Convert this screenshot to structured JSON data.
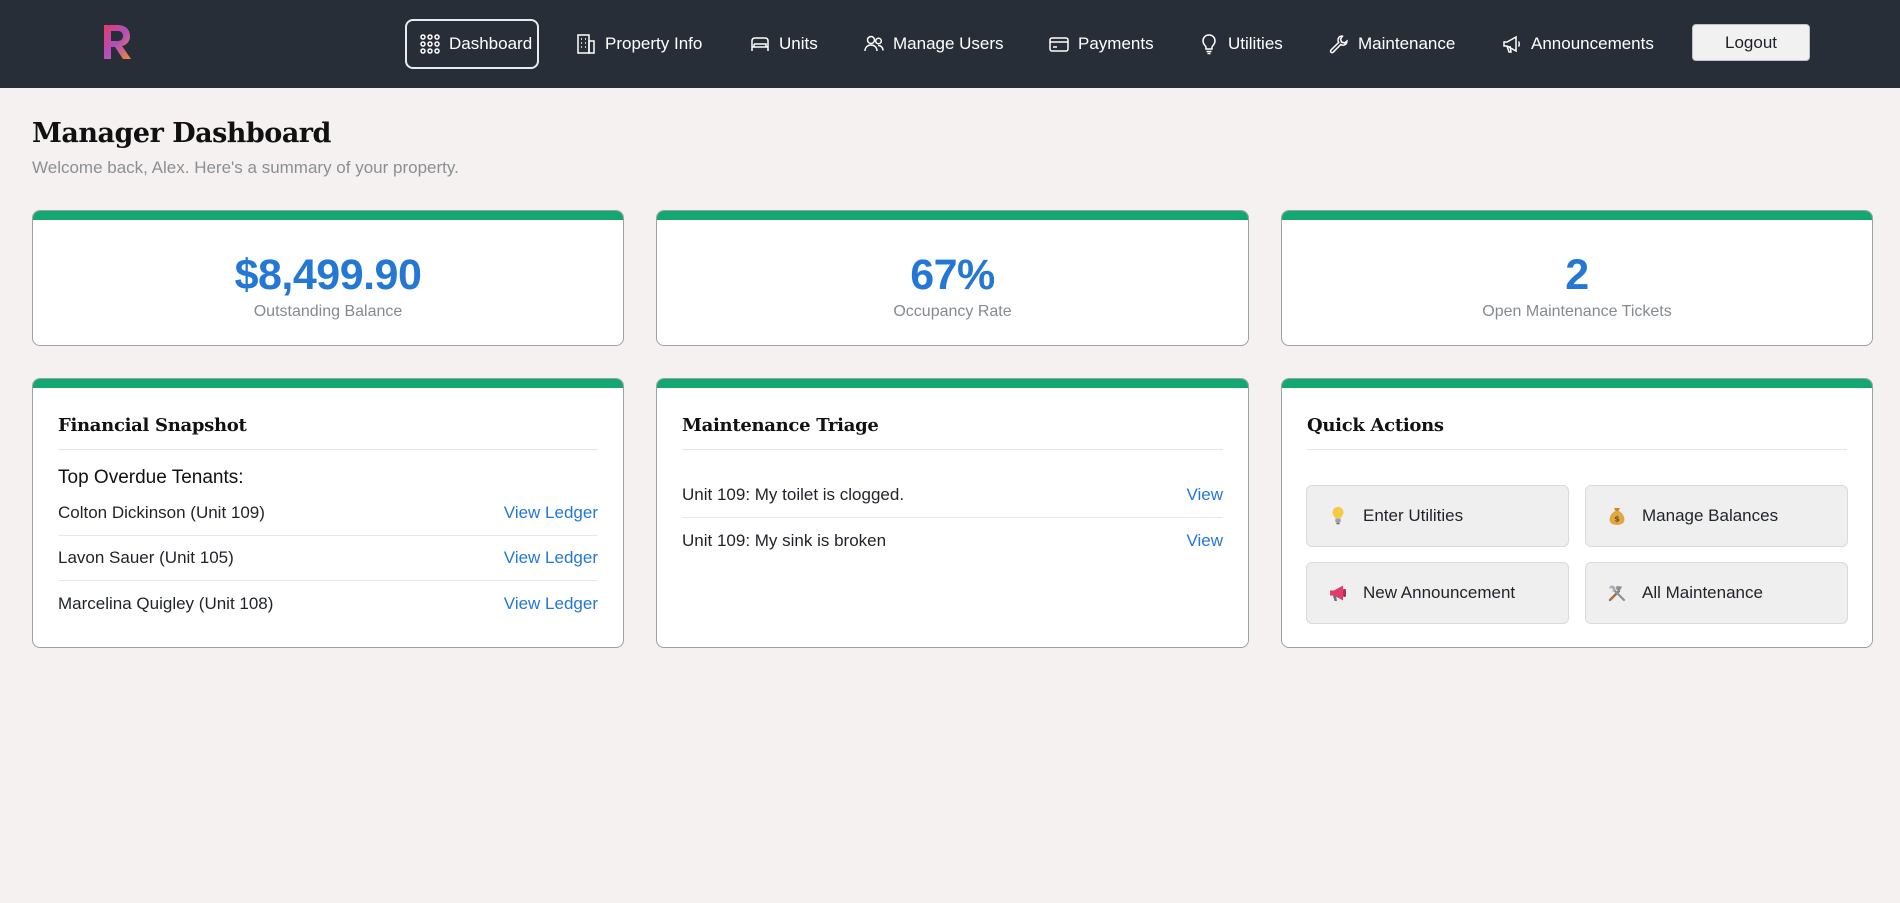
{
  "nav": {
    "items": [
      {
        "label": "Dashboard",
        "icon": "grid-icon",
        "active": true
      },
      {
        "label": "Property Info",
        "icon": "building-icon"
      },
      {
        "label": "Units",
        "icon": "bed-icon"
      },
      {
        "label": "Manage Users",
        "icon": "users-icon"
      },
      {
        "label": "Payments",
        "icon": "credit-card-icon"
      },
      {
        "label": "Utilities",
        "icon": "lightbulb-icon"
      },
      {
        "label": "Maintenance",
        "icon": "wrench-icon"
      },
      {
        "label": "Announcements",
        "icon": "megaphone-icon"
      }
    ],
    "logout_label": "Logout"
  },
  "page": {
    "title": "Manager Dashboard",
    "subtitle": "Welcome back, Alex. Here's a summary of your property."
  },
  "stats": [
    {
      "value": "$8,499.90",
      "label": "Outstanding Balance"
    },
    {
      "value": "67%",
      "label": "Occupancy Rate"
    },
    {
      "value": "2",
      "label": "Open Maintenance Tickets"
    }
  ],
  "financial": {
    "title": "Financial Snapshot",
    "heading": "Top Overdue Tenants:",
    "rows": [
      {
        "name": "Colton Dickinson (Unit 109)",
        "link": "View Ledger"
      },
      {
        "name": "Lavon Sauer (Unit 105)",
        "link": "View Ledger"
      },
      {
        "name": "Marcelina Quigley (Unit 108)",
        "link": "View Ledger"
      }
    ]
  },
  "maintenance": {
    "title": "Maintenance Triage",
    "rows": [
      {
        "text": "Unit 109: My toilet is clogged.",
        "link": "View"
      },
      {
        "text": "Unit 109: My sink is broken",
        "link": "View"
      }
    ]
  },
  "quick_actions": {
    "title": "Quick Actions",
    "buttons": [
      {
        "label": "Enter Utilities",
        "icon": "lightbulb-emoji-icon"
      },
      {
        "label": "Manage Balances",
        "icon": "money-bag-emoji-icon"
      },
      {
        "label": "New Announcement",
        "icon": "megaphone-emoji-icon"
      },
      {
        "label": "All Maintenance",
        "icon": "tools-emoji-icon"
      }
    ]
  },
  "colors": {
    "header_bg": "#282e37",
    "accent_green": "#13a772",
    "link_blue": "#2478d4",
    "page_bg": "#f5f1f0"
  }
}
